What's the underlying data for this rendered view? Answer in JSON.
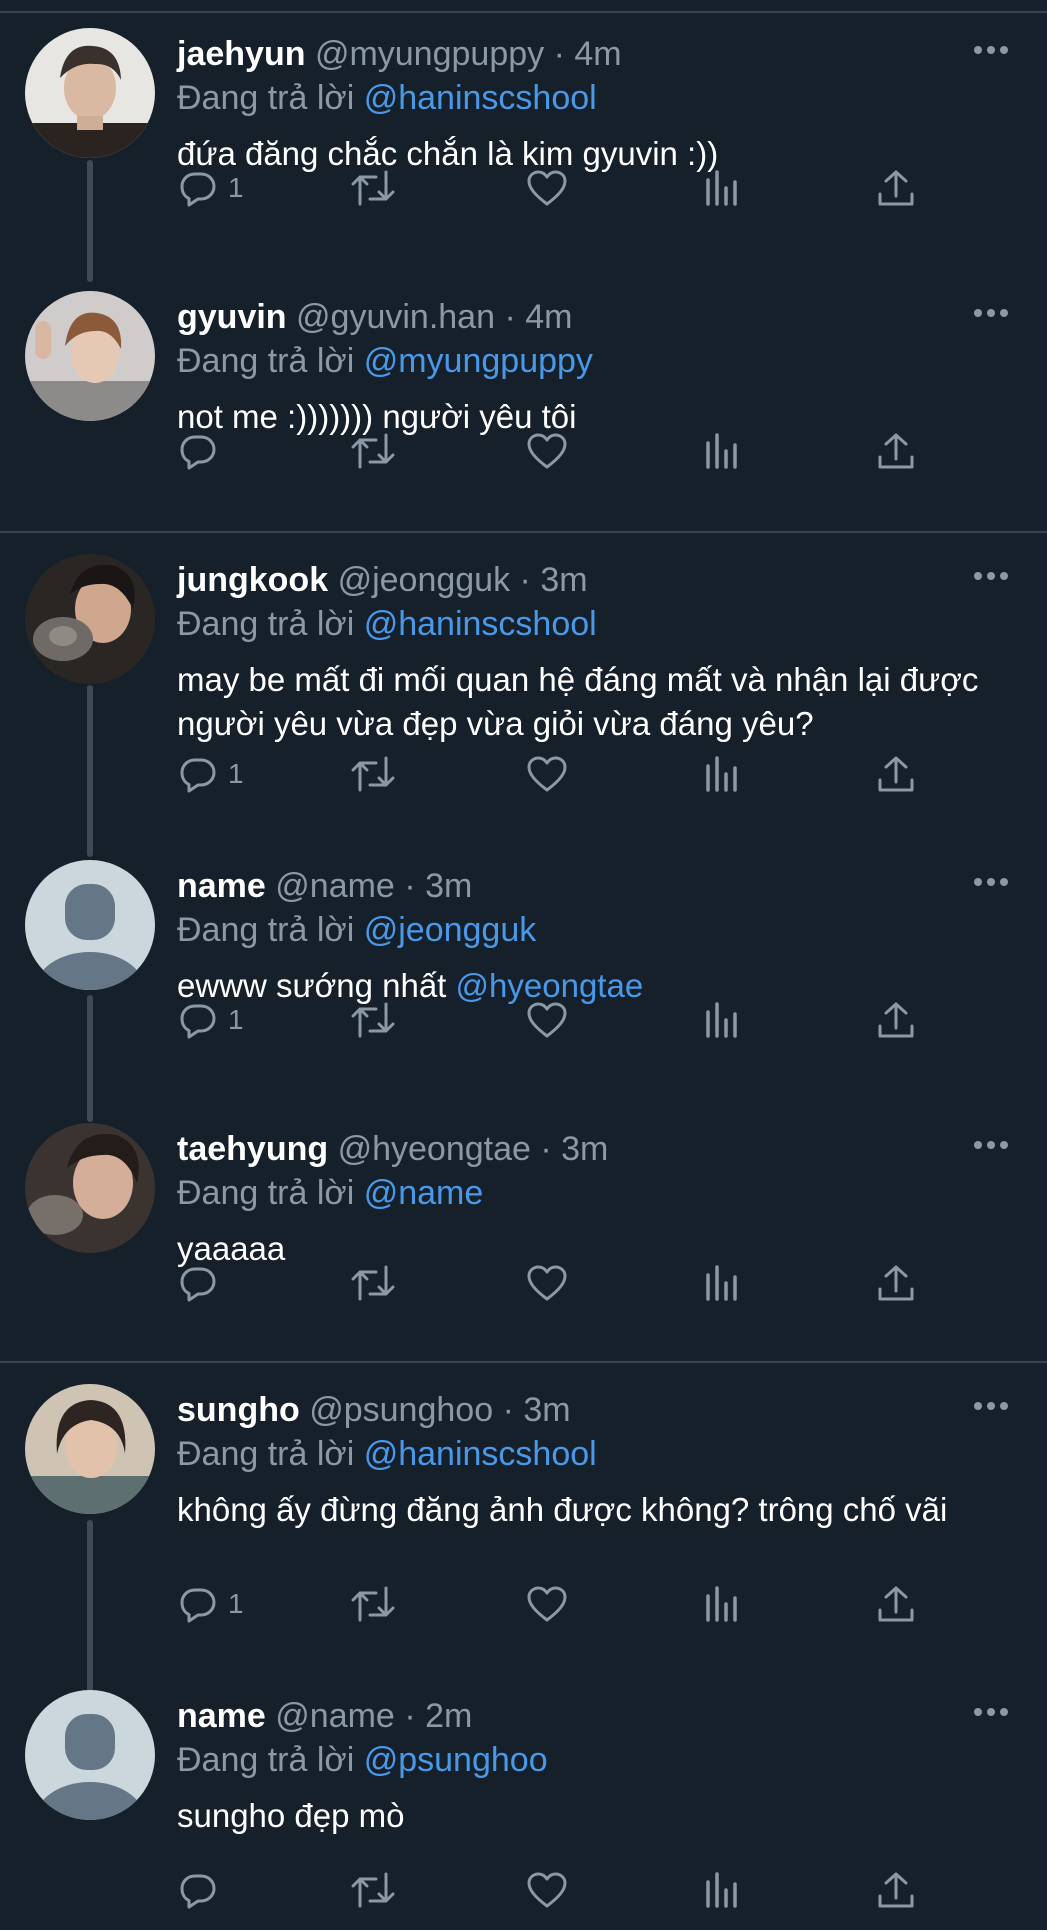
{
  "reply_prefix": "Đang trả lời",
  "colors": {
    "background": "#15202b",
    "link": "#4a99e9",
    "muted": "#8b98a5",
    "divider": "#38444d"
  },
  "icons": {
    "reply": "reply-icon",
    "retweet": "retweet-icon",
    "like": "heart-icon",
    "views": "analytics-icon",
    "share": "share-icon",
    "more": "more-dots-icon"
  },
  "tweets": [
    {
      "name": "jaehyun",
      "handle": "@myungpuppy",
      "time": "4m",
      "reply_to": "@haninscshool",
      "text": "đứa đăng chắc chắn là kim gyuvin :))",
      "text_mention": "",
      "reply_count": "1",
      "avatar": "photo-avatar"
    },
    {
      "name": "gyuvin",
      "handle": "@gyuvin.han",
      "time": "4m",
      "reply_to": "@myungpuppy",
      "text": "not me :))))))) người yêu tôi",
      "text_mention": "",
      "reply_count": "",
      "avatar": "photo-avatar"
    },
    {
      "name": "jungkook",
      "handle": "@jeongguk",
      "time": "3m",
      "reply_to": "@haninscshool",
      "text": "may be mất đi mối quan hệ đáng mất và nhận lại được người yêu vừa đẹp vừa giỏi vừa đáng yêu?",
      "text_mention": "",
      "reply_count": "1",
      "avatar": "photo-avatar"
    },
    {
      "name": "name",
      "handle": "@name",
      "time": "3m",
      "reply_to": "@jeongguk",
      "text": "ewww sướng nhất ",
      "text_mention": "@hyeongtae",
      "reply_count": "1",
      "avatar": "default-avatar"
    },
    {
      "name": "taehyung",
      "handle": "@hyeongtae",
      "time": "3m",
      "reply_to": "@name",
      "text": "yaaaaa",
      "text_mention": "",
      "reply_count": "",
      "avatar": "photo-avatar"
    },
    {
      "name": "sungho",
      "handle": "@psunghoo",
      "time": "3m",
      "reply_to": "@haninscshool",
      "text": "không ấy đừng đăng ảnh được không? trông chố vãi",
      "text_mention": "",
      "reply_count": "1",
      "avatar": "photo-avatar"
    },
    {
      "name": "name",
      "handle": "@name",
      "time": "2m",
      "reply_to": "@psunghoo",
      "text": "sungho đẹp mò",
      "text_mention": "",
      "reply_count": "",
      "avatar": "default-avatar"
    }
  ]
}
